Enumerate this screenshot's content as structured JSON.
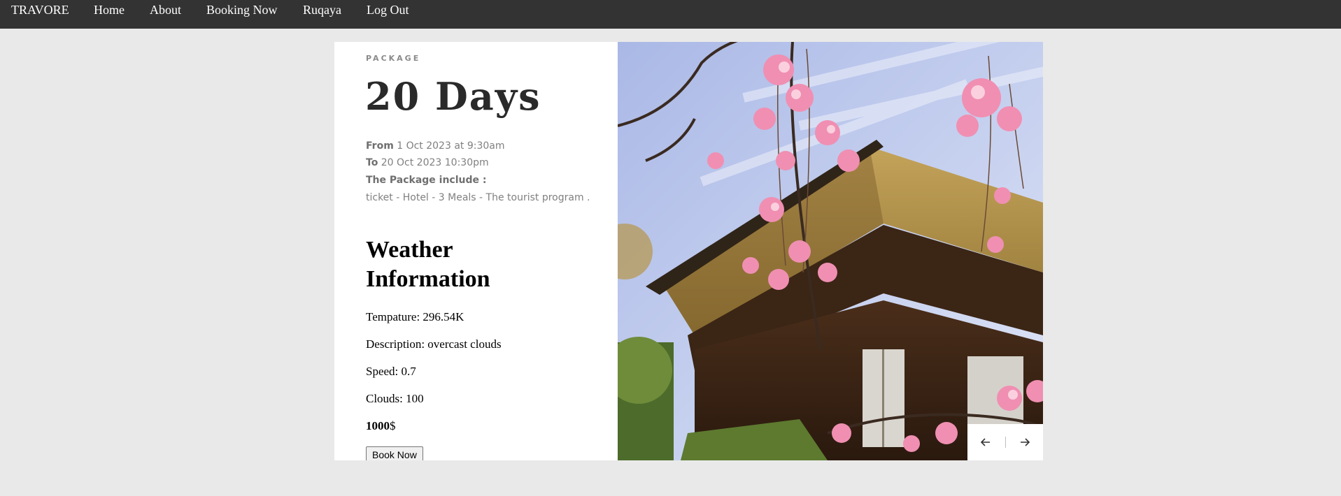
{
  "nav": {
    "brand": "TRAVORE",
    "items": [
      "Home",
      "About",
      "Booking Now",
      "Ruqaya",
      "Log Out"
    ]
  },
  "package": {
    "eyebrow": "PACKAGE",
    "title": "20 Days",
    "from_label": "From",
    "from_value": " 1 Oct 2023 at 9:30am",
    "to_label": "To",
    "to_value": " 20 Oct 2023 10:30pm",
    "include_label": "The Package include :",
    "include_value": "ticket - Hotel - 3 Meals - The tourist program ."
  },
  "weather": {
    "title": "Weather Information",
    "temperature": "Tempature: 296.54K",
    "description": "Description: overcast clouds",
    "speed": "Speed: 0.7",
    "clouds": "Clouds: 100"
  },
  "price": {
    "amount": "1000",
    "currency": "$"
  },
  "book_button": "Book Now",
  "slider": {
    "prev_icon": "arrow-left-icon",
    "next_icon": "arrow-right-icon"
  },
  "colors": {
    "navbar": "#333333",
    "page_bg": "#e9e9e9",
    "title": "#2a2a2a",
    "muted": "#808080"
  }
}
